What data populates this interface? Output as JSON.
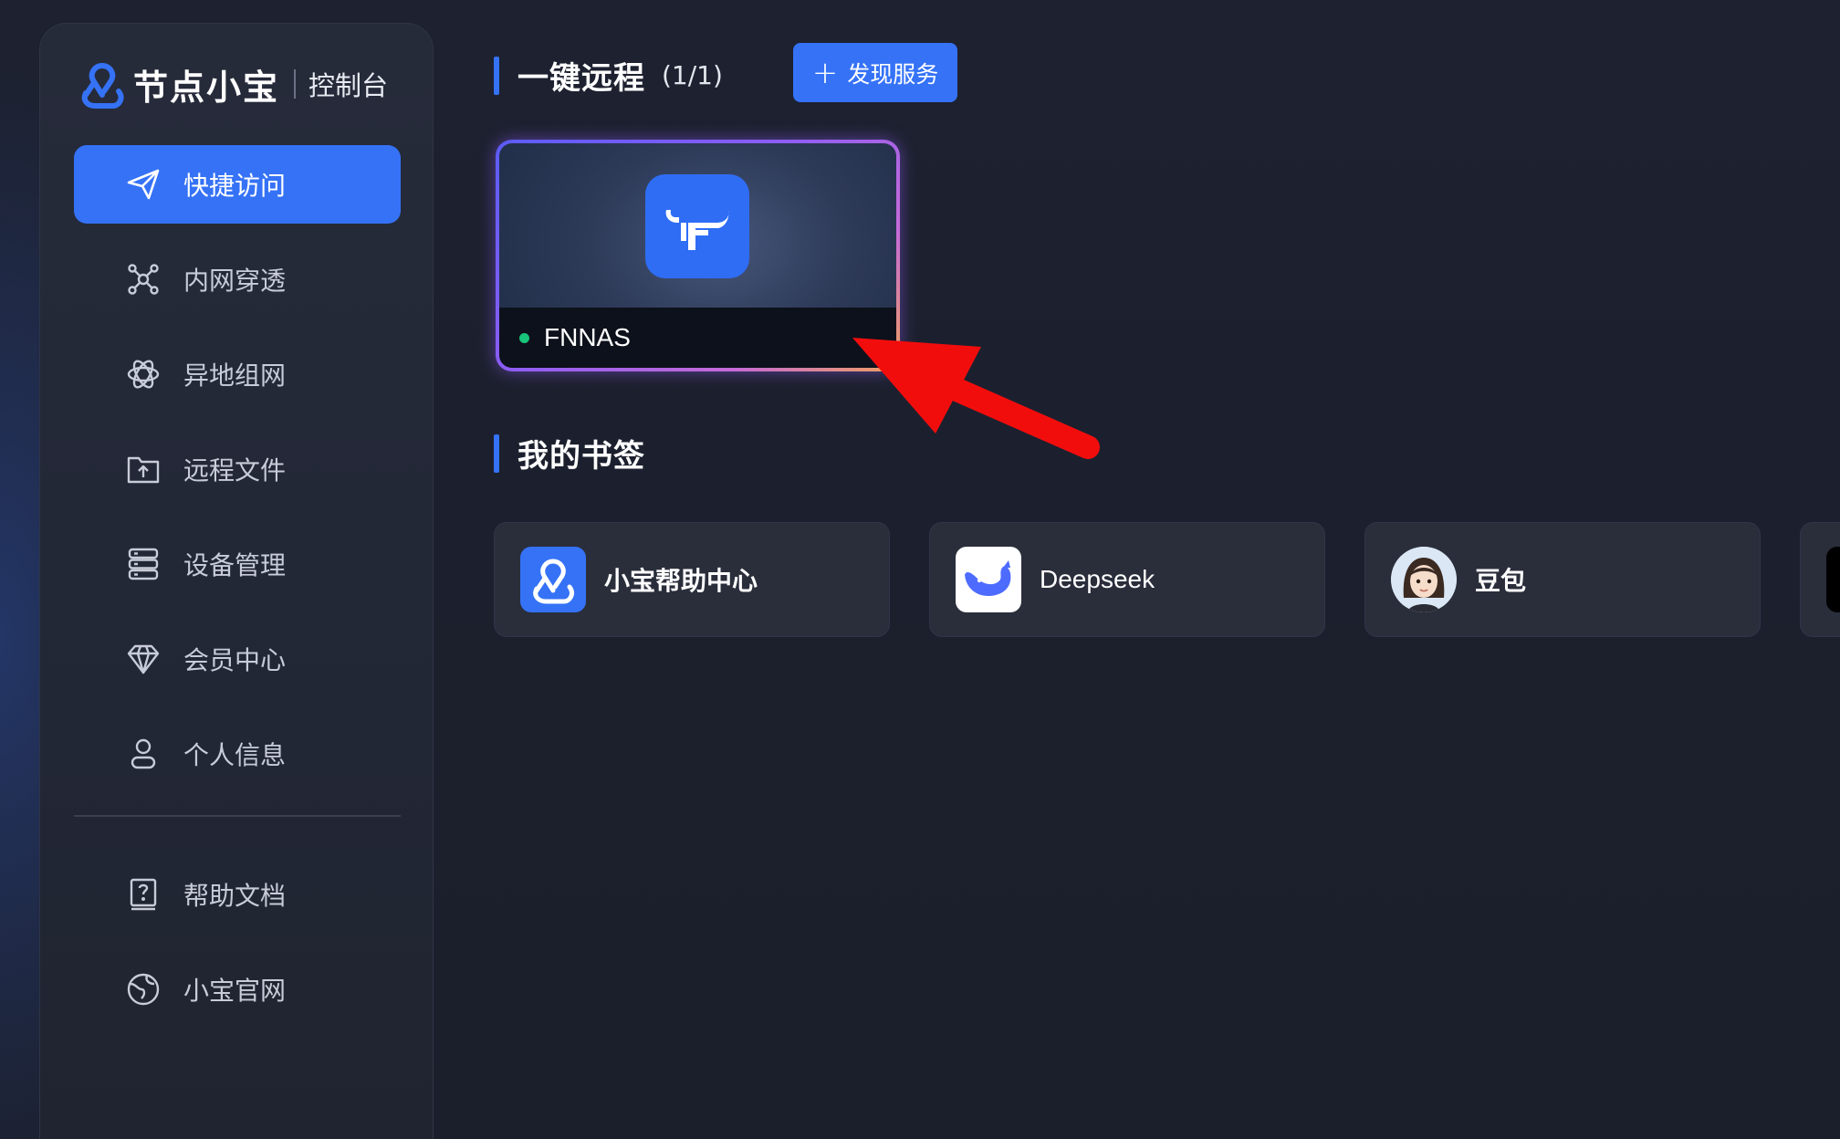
{
  "brand": {
    "name": "节点小宝",
    "subtitle": "控制台",
    "logo_icon": "triple-ring-logo-icon",
    "logo_color": "#3572f6"
  },
  "sidebar": {
    "items": [
      {
        "label": "快捷访问",
        "icon": "paper-plane-icon",
        "active": true
      },
      {
        "label": "内网穿透",
        "icon": "network-nodes-icon",
        "active": false
      },
      {
        "label": "异地组网",
        "icon": "atom-icon",
        "active": false
      },
      {
        "label": "远程文件",
        "icon": "folder-upload-icon",
        "active": false
      },
      {
        "label": "设备管理",
        "icon": "server-icon",
        "active": false
      },
      {
        "label": "会员中心",
        "icon": "diamond-icon",
        "active": false
      },
      {
        "label": "个人信息",
        "icon": "user-icon",
        "active": false
      }
    ],
    "bottom_items": [
      {
        "label": "帮助文档",
        "icon": "help-book-icon"
      },
      {
        "label": "小宝官网",
        "icon": "globe-icon"
      }
    ]
  },
  "remote": {
    "title": "一键远程",
    "count": "(1/1)",
    "discover_label": "发现服务",
    "discover_icon": "plus-icon",
    "services": [
      {
        "name": "FNNAS",
        "status": "online",
        "status_color": "#18c47a",
        "icon": "bull-logo-icon"
      }
    ]
  },
  "bookmarks": {
    "title": "我的书签",
    "items": [
      {
        "label": "小宝帮助中心",
        "icon": "triple-ring-logo-icon"
      },
      {
        "label": "Deepseek",
        "icon": "whale-icon"
      },
      {
        "label": "豆包",
        "icon": "avatar-girl-icon"
      }
    ]
  },
  "colors": {
    "accent": "#3572f6",
    "background": "#1b1f2b",
    "card": "#2a2e3b",
    "annotation_arrow": "#f20d0d"
  }
}
